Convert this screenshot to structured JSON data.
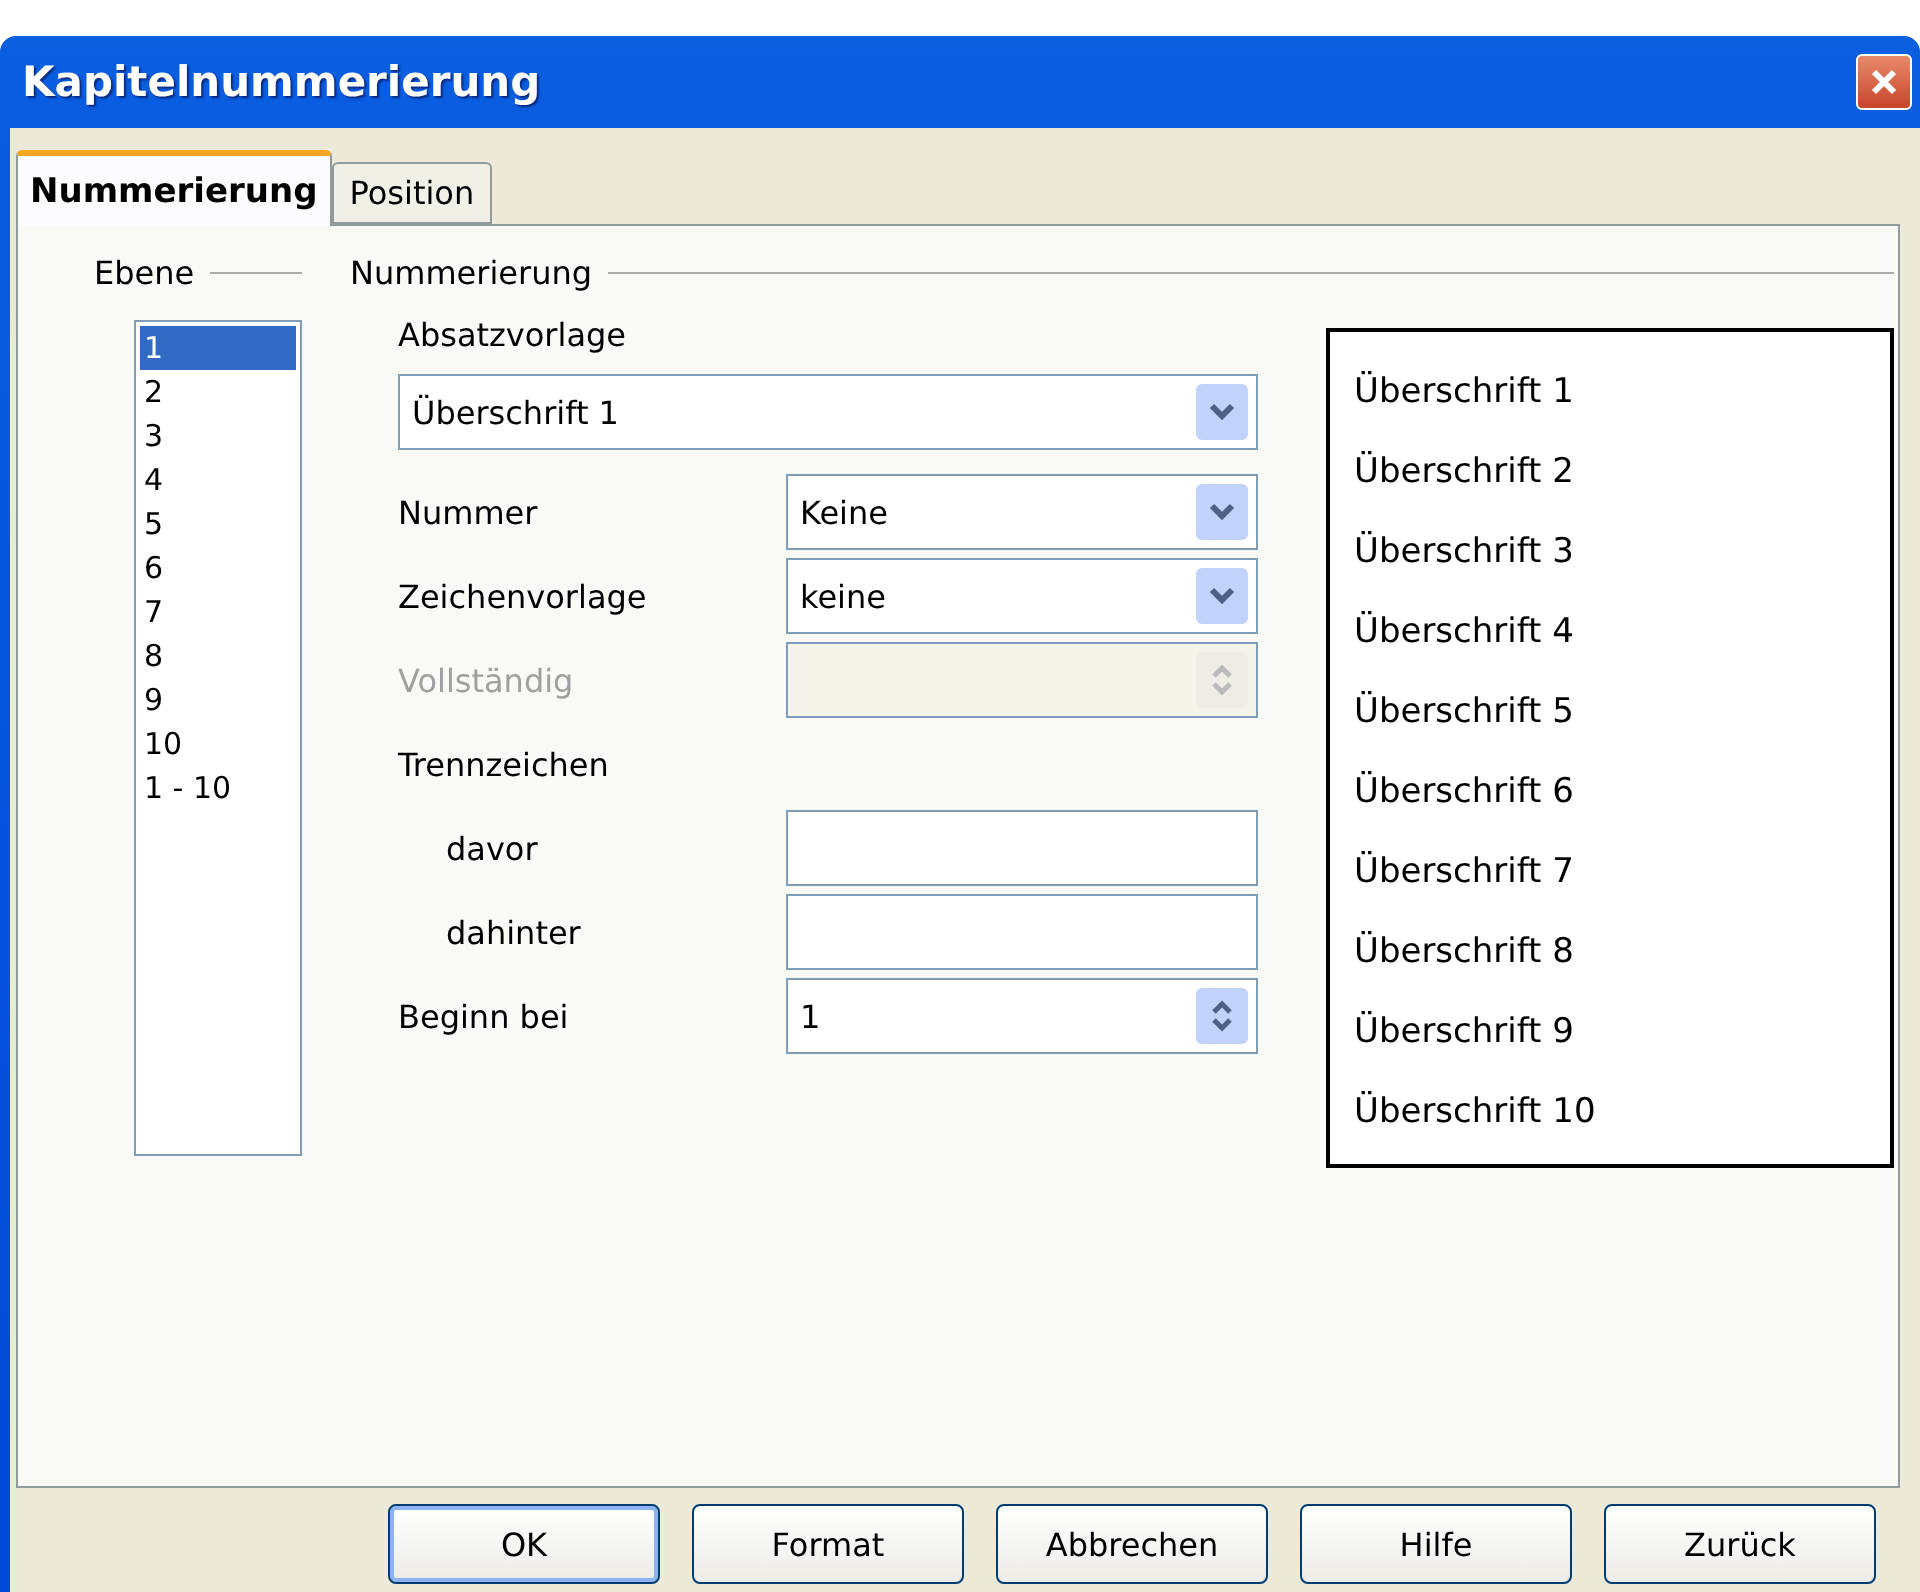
{
  "window": {
    "title": "Kapitelnummerierung"
  },
  "tabs": [
    {
      "label": "Nummerierung",
      "selected": true
    },
    {
      "label": "Position",
      "selected": false
    }
  ],
  "level_group": {
    "title": "Ebene",
    "items": [
      {
        "label": "1",
        "selected": true
      },
      {
        "label": "2",
        "selected": false
      },
      {
        "label": "3",
        "selected": false
      },
      {
        "label": "4",
        "selected": false
      },
      {
        "label": "5",
        "selected": false
      },
      {
        "label": "6",
        "selected": false
      },
      {
        "label": "7",
        "selected": false
      },
      {
        "label": "8",
        "selected": false
      },
      {
        "label": "9",
        "selected": false
      },
      {
        "label": "10",
        "selected": false
      },
      {
        "label": "1 - 10",
        "selected": false
      }
    ]
  },
  "numbering_group": {
    "title": "Nummerierung",
    "paragraph_style": {
      "label": "Absatzvorlage",
      "value": "Überschrift 1"
    },
    "fields": [
      {
        "kind": "dropdown",
        "label": "Nummer",
        "value": "Keine",
        "disabled": false,
        "indented": false
      },
      {
        "kind": "dropdown",
        "label": "Zeichenvorlage",
        "value": "keine",
        "disabled": false,
        "indented": false
      },
      {
        "kind": "spin",
        "label": "Vollständig",
        "disabled": true,
        "indented": false
      },
      {
        "kind": "heading",
        "label": "Trennzeichen",
        "disabled": false,
        "indented": false
      },
      {
        "kind": "text",
        "label": "davor",
        "disabled": false,
        "indented": true
      },
      {
        "kind": "text",
        "label": "dahinter",
        "disabled": false,
        "indented": true
      },
      {
        "kind": "spin",
        "label": "Beginn bei",
        "value": "1",
        "disabled": false,
        "indented": false
      }
    ]
  },
  "preview": [
    "Überschrift 1",
    "Überschrift 2",
    "Überschrift 3",
    "Überschrift 4",
    "Überschrift 5",
    "Überschrift 6",
    "Überschrift 7",
    "Überschrift 8",
    "Überschrift 9",
    "Überschrift 10"
  ],
  "buttons": [
    {
      "label": "OK",
      "default": true
    },
    {
      "label": "Format",
      "default": false
    },
    {
      "label": "Abbrechen",
      "default": false
    },
    {
      "label": "Hilfe",
      "default": false
    },
    {
      "label": "Zurück",
      "default": false
    }
  ]
}
